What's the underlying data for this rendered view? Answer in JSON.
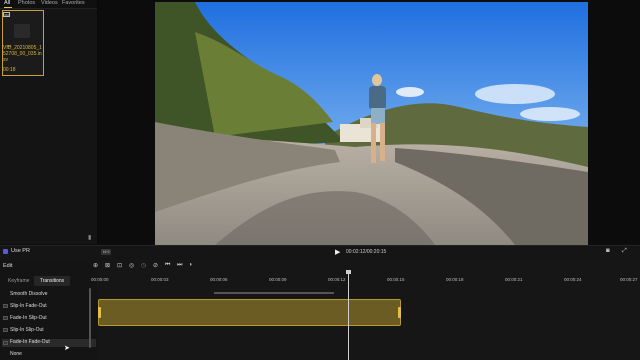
{
  "library": {
    "tabs": [
      "All",
      "Photos",
      "Videos",
      "Favorites"
    ],
    "clip": {
      "name": "VID_20210805_152708_00_035.insv",
      "duration": "00:18",
      "badge": "360"
    }
  },
  "player": {
    "plugin_label": "Use PR",
    "ratio_label": "16:9",
    "timecode": "00:02:12/00:20:15"
  },
  "editor": {
    "panel_title": "Edit",
    "tabs": [
      "Keyframe",
      "Transitions"
    ],
    "transitions": [
      "Smooth Dissolve",
      "Slip-In Fade-Out",
      "Fade-In Slip-Out",
      "Slip-In Slip-Out",
      "Fade-In Fade-Out",
      "None"
    ]
  },
  "timeline": {
    "ticks": [
      "00:00:00",
      "00:00:03",
      "00:00:06",
      "00:00:09",
      "00:00:12",
      "00:00:15",
      "00:00:18",
      "00:00:21",
      "00:00:24",
      "00:00:27"
    ]
  },
  "colors": {
    "accent": "#e7c24a",
    "clip_fill": "#6b5c23"
  }
}
